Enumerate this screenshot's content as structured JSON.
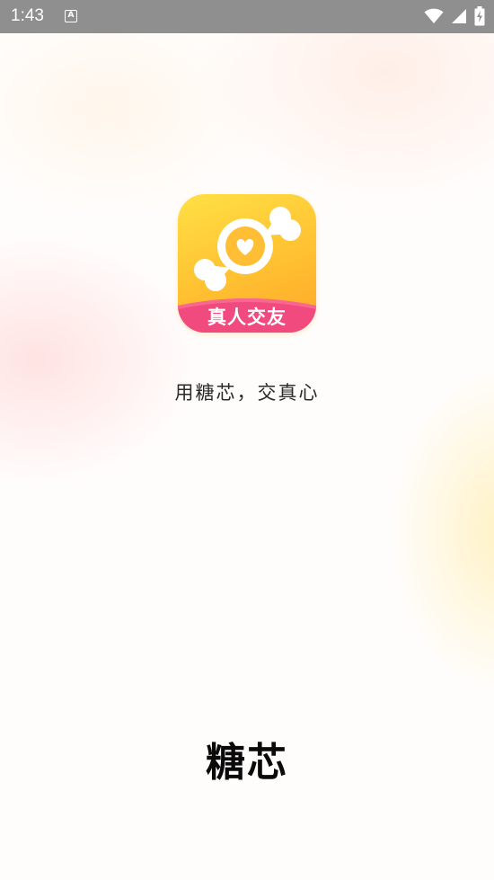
{
  "status_bar": {
    "time": "1:43",
    "notification_icon": "a-notification-icon",
    "notification_letter": "A",
    "wifi_icon": "wifi-icon",
    "signal_icon": "signal-icon",
    "battery_icon": "battery-charging-icon"
  },
  "splash": {
    "logo_icon": "candy-heart-icon",
    "logo_band_text": "真人交友",
    "slogan": "用糖芯，交真心",
    "brand_name": "糖芯"
  },
  "colors": {
    "status_bar": "#8f8f8f",
    "logo_yellow": "#ffd93d",
    "logo_orange": "#ffa728",
    "band_pink": "#f04a7e",
    "text_dark": "#0a0a0a"
  }
}
